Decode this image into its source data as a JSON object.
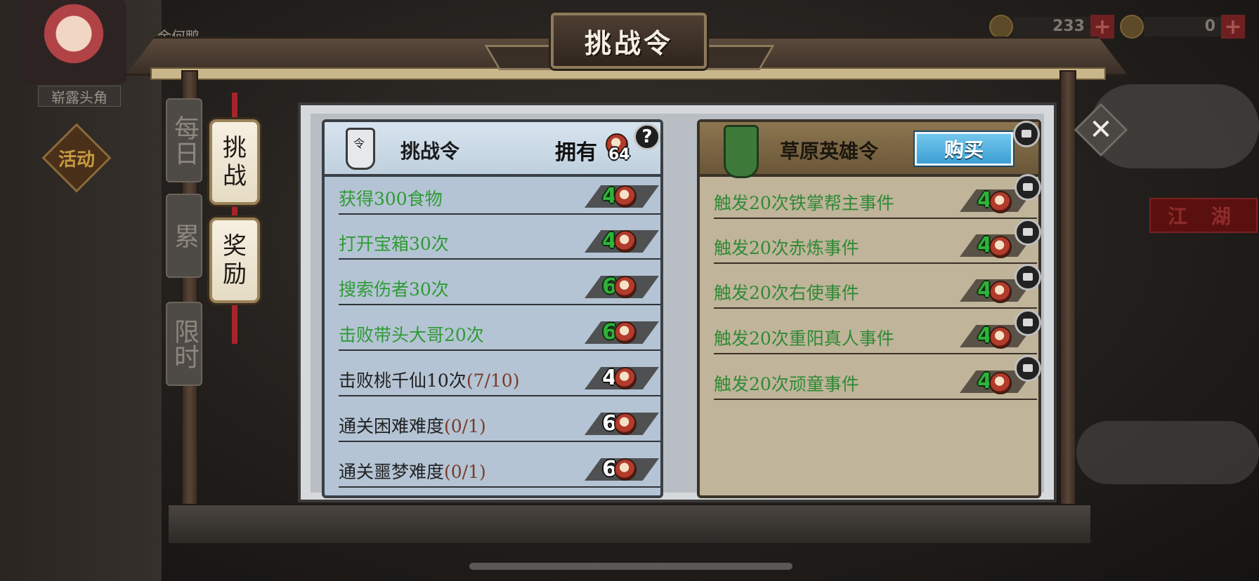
{
  "header": {
    "title": "挑战令"
  },
  "player": {
    "name": "余何鸭",
    "tag": "崭露头角"
  },
  "event_badge": "活动",
  "jianghu_label": "江 湖",
  "resources": [
    {
      "icon": "food-leaf-icon",
      "value": "233"
    },
    {
      "icon": "gold-ingot-icon",
      "value": "0"
    }
  ],
  "side_tabs": [
    {
      "label": "挑战",
      "active": true
    },
    {
      "label": "奖励",
      "active": false
    }
  ],
  "ghost_tabs": [
    "每日",
    "累",
    "限时"
  ],
  "left_card": {
    "title": "挑战令",
    "own_label": "拥有",
    "own_count": "64",
    "help": "?",
    "tasks": [
      {
        "text": "获得300食物",
        "progress": "",
        "reward": "4",
        "completed": true
      },
      {
        "text": "打开宝箱30次",
        "progress": "",
        "reward": "4",
        "completed": true
      },
      {
        "text": "搜索伤者30次",
        "progress": "",
        "reward": "6",
        "completed": true
      },
      {
        "text": "击败带头大哥20次",
        "progress": "",
        "reward": "6",
        "completed": true
      },
      {
        "text": "击败桃千仙10次",
        "progress": "(7/10)",
        "reward": "4",
        "completed": false
      },
      {
        "text": "通关困难难度",
        "progress": "(0/1)",
        "reward": "6",
        "completed": false
      },
      {
        "text": "通关噩梦难度",
        "progress": "(0/1)",
        "reward": "6",
        "completed": false
      }
    ]
  },
  "right_card": {
    "title": "草原英雄令",
    "buy_label": "购买",
    "tasks": [
      {
        "text": "触发20次铁掌帮主事件",
        "reward": "4",
        "locked": true
      },
      {
        "text": "触发20次赤炼事件",
        "reward": "4",
        "locked": true
      },
      {
        "text": "触发20次右使事件",
        "reward": "4",
        "locked": true
      },
      {
        "text": "触发20次重阳真人事件",
        "reward": "4",
        "locked": true
      },
      {
        "text": "触发20次顽童事件",
        "reward": "4",
        "locked": true
      }
    ]
  },
  "colors": {
    "completed_green": "#2f9a35",
    "buy_blue": "#3c9fd2",
    "left_card_bg": "#b4c4d4",
    "right_card_bg": "#c0b49a"
  }
}
